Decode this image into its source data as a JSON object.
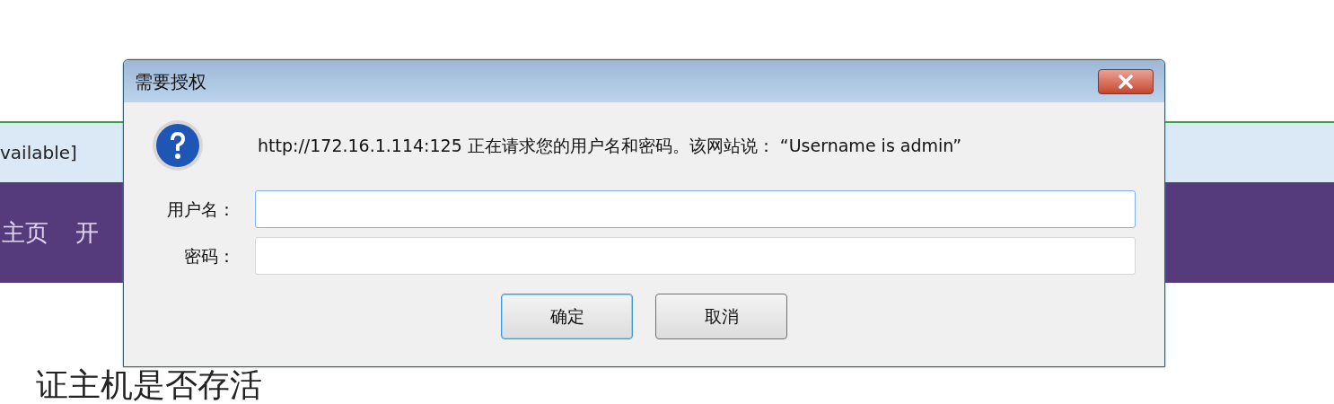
{
  "page": {
    "info_bar": "vailable]",
    "nav_items": [
      "主页",
      "开"
    ],
    "heading": "证主机是否存活"
  },
  "dialog": {
    "title": "需要授权",
    "message": "http://172.16.1.114:125 正在请求您的用户名和密码。该网站说： “Username is admin”",
    "fields": [
      {
        "label": "用户名：",
        "focused": true
      },
      {
        "label": "密码：",
        "focused": false
      }
    ],
    "buttons": [
      {
        "label": "确定",
        "default": true
      },
      {
        "label": "取消",
        "default": false
      }
    ]
  }
}
